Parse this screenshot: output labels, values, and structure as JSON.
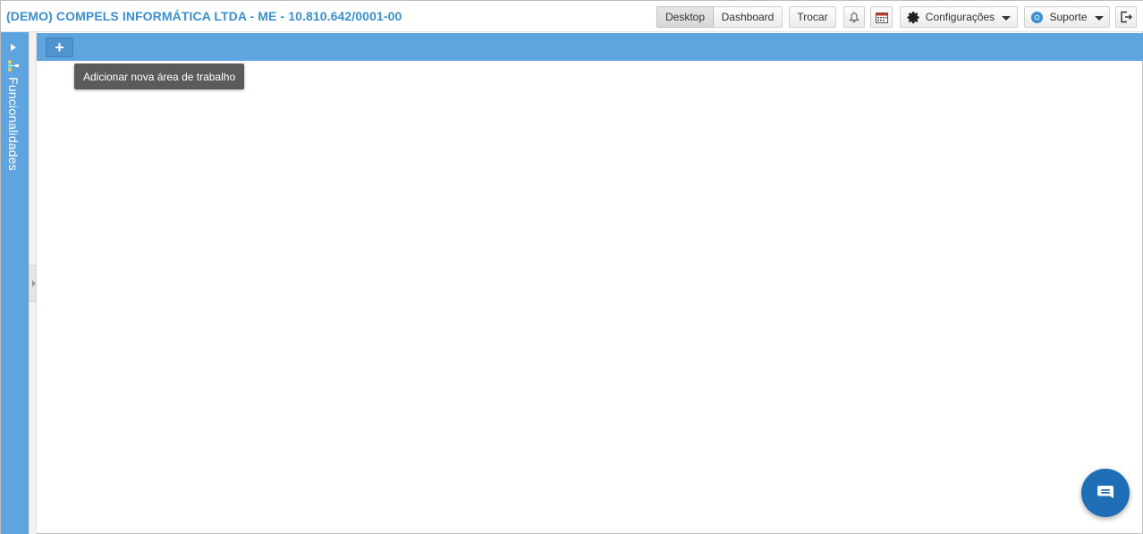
{
  "header": {
    "company": "(DEMO) COMPELS INFORMÁTICA LTDA - ME - 10.810.642/0001-00",
    "view_toggle": {
      "desktop": "Desktop",
      "dashboard": "Dashboard",
      "selected": "Desktop"
    },
    "switch_label": "Trocar",
    "settings_label": "Configurações",
    "support_label": "Suporte",
    "icons": [
      "bell-icon",
      "calendar-icon",
      "gear-icon",
      "support-icon",
      "logout-icon"
    ]
  },
  "sidebar": {
    "label": "Funcionalidades"
  },
  "workspace": {
    "add_tooltip": "Adicionar nova área de trabalho"
  },
  "colors": {
    "brand_blue": "#3a8fd1",
    "sidebar_blue": "#5ea5e0",
    "chat_blue": "#1e6fb6"
  }
}
